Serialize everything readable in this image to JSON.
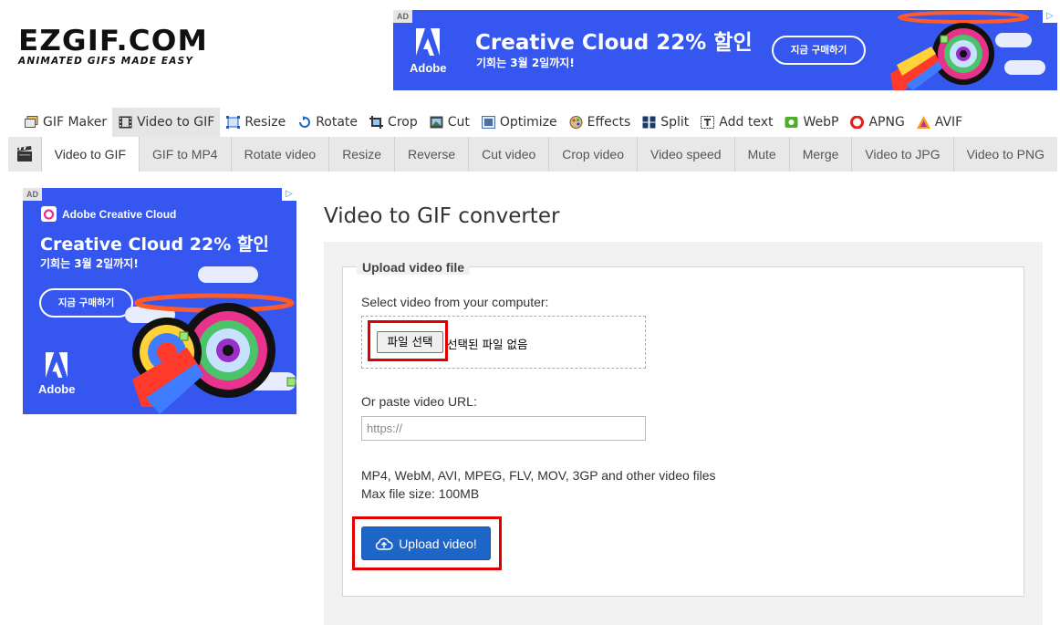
{
  "logo": {
    "name": "EZGIF.COM",
    "tagline": "ANIMATED GIFS MADE EASY"
  },
  "top_ad": {
    "ad_label": "AD",
    "info_icon": "adchoices-icon",
    "brand": "Adobe",
    "title": "Creative Cloud 22% 할인",
    "subtitle": "기회는 3월 2일까지!",
    "cta": "지금 구매하기",
    "background_color": "#3557f0"
  },
  "main_nav": {
    "items": [
      {
        "label": "GIF Maker",
        "icon": "gif-maker-icon",
        "active": false
      },
      {
        "label": "Video to GIF",
        "icon": "film-icon",
        "active": true
      },
      {
        "label": "Resize",
        "icon": "resize-icon",
        "active": false
      },
      {
        "label": "Rotate",
        "icon": "rotate-icon",
        "active": false
      },
      {
        "label": "Crop",
        "icon": "crop-icon",
        "active": false
      },
      {
        "label": "Cut",
        "icon": "cut-icon",
        "active": false
      },
      {
        "label": "Optimize",
        "icon": "optimize-icon",
        "active": false
      },
      {
        "label": "Effects",
        "icon": "effects-icon",
        "active": false
      },
      {
        "label": "Split",
        "icon": "split-icon",
        "active": false
      },
      {
        "label": "Add text",
        "icon": "add-text-icon",
        "active": false
      },
      {
        "label": "WebP",
        "icon": "webp-icon",
        "active": false
      },
      {
        "label": "APNG",
        "icon": "apng-icon",
        "active": false
      },
      {
        "label": "AVIF",
        "icon": "avif-icon",
        "active": false
      }
    ]
  },
  "sub_nav": {
    "icon": "clapperboard-icon",
    "items": [
      {
        "label": "Video to GIF",
        "active": true
      },
      {
        "label": "GIF to MP4",
        "active": false
      },
      {
        "label": "Rotate video",
        "active": false
      },
      {
        "label": "Resize",
        "active": false
      },
      {
        "label": "Reverse",
        "active": false
      },
      {
        "label": "Cut video",
        "active": false
      },
      {
        "label": "Crop video",
        "active": false
      },
      {
        "label": "Video speed",
        "active": false
      },
      {
        "label": "Mute",
        "active": false
      },
      {
        "label": "Merge",
        "active": false
      },
      {
        "label": "Video to JPG",
        "active": false
      },
      {
        "label": "Video to PNG",
        "active": false
      }
    ]
  },
  "side_ad": {
    "ad_label": "AD",
    "brand_line": "Adobe Creative Cloud",
    "title": "Creative Cloud 22% 할인",
    "subtitle": "기회는 3월 2일까지!",
    "cta": "지금 구매하기",
    "brand": "Adobe"
  },
  "main": {
    "page_title": "Video to GIF converter",
    "upload_legend": "Upload video file",
    "select_label": "Select video from your computer:",
    "file_button": "파일 선택",
    "file_status": "선택된 파일 없음",
    "url_label": "Or paste video URL:",
    "url_placeholder": "https://",
    "url_value": "",
    "formats_text": "MP4, WebM, AVI, MPEG, FLV, MOV, 3GP and other video files",
    "max_size_text": "Max file size: 100MB",
    "upload_button": "Upload video!",
    "upload_icon": "cloud-upload-icon",
    "accent_color": "#1e65c8",
    "highlight_color": "#e00000"
  }
}
